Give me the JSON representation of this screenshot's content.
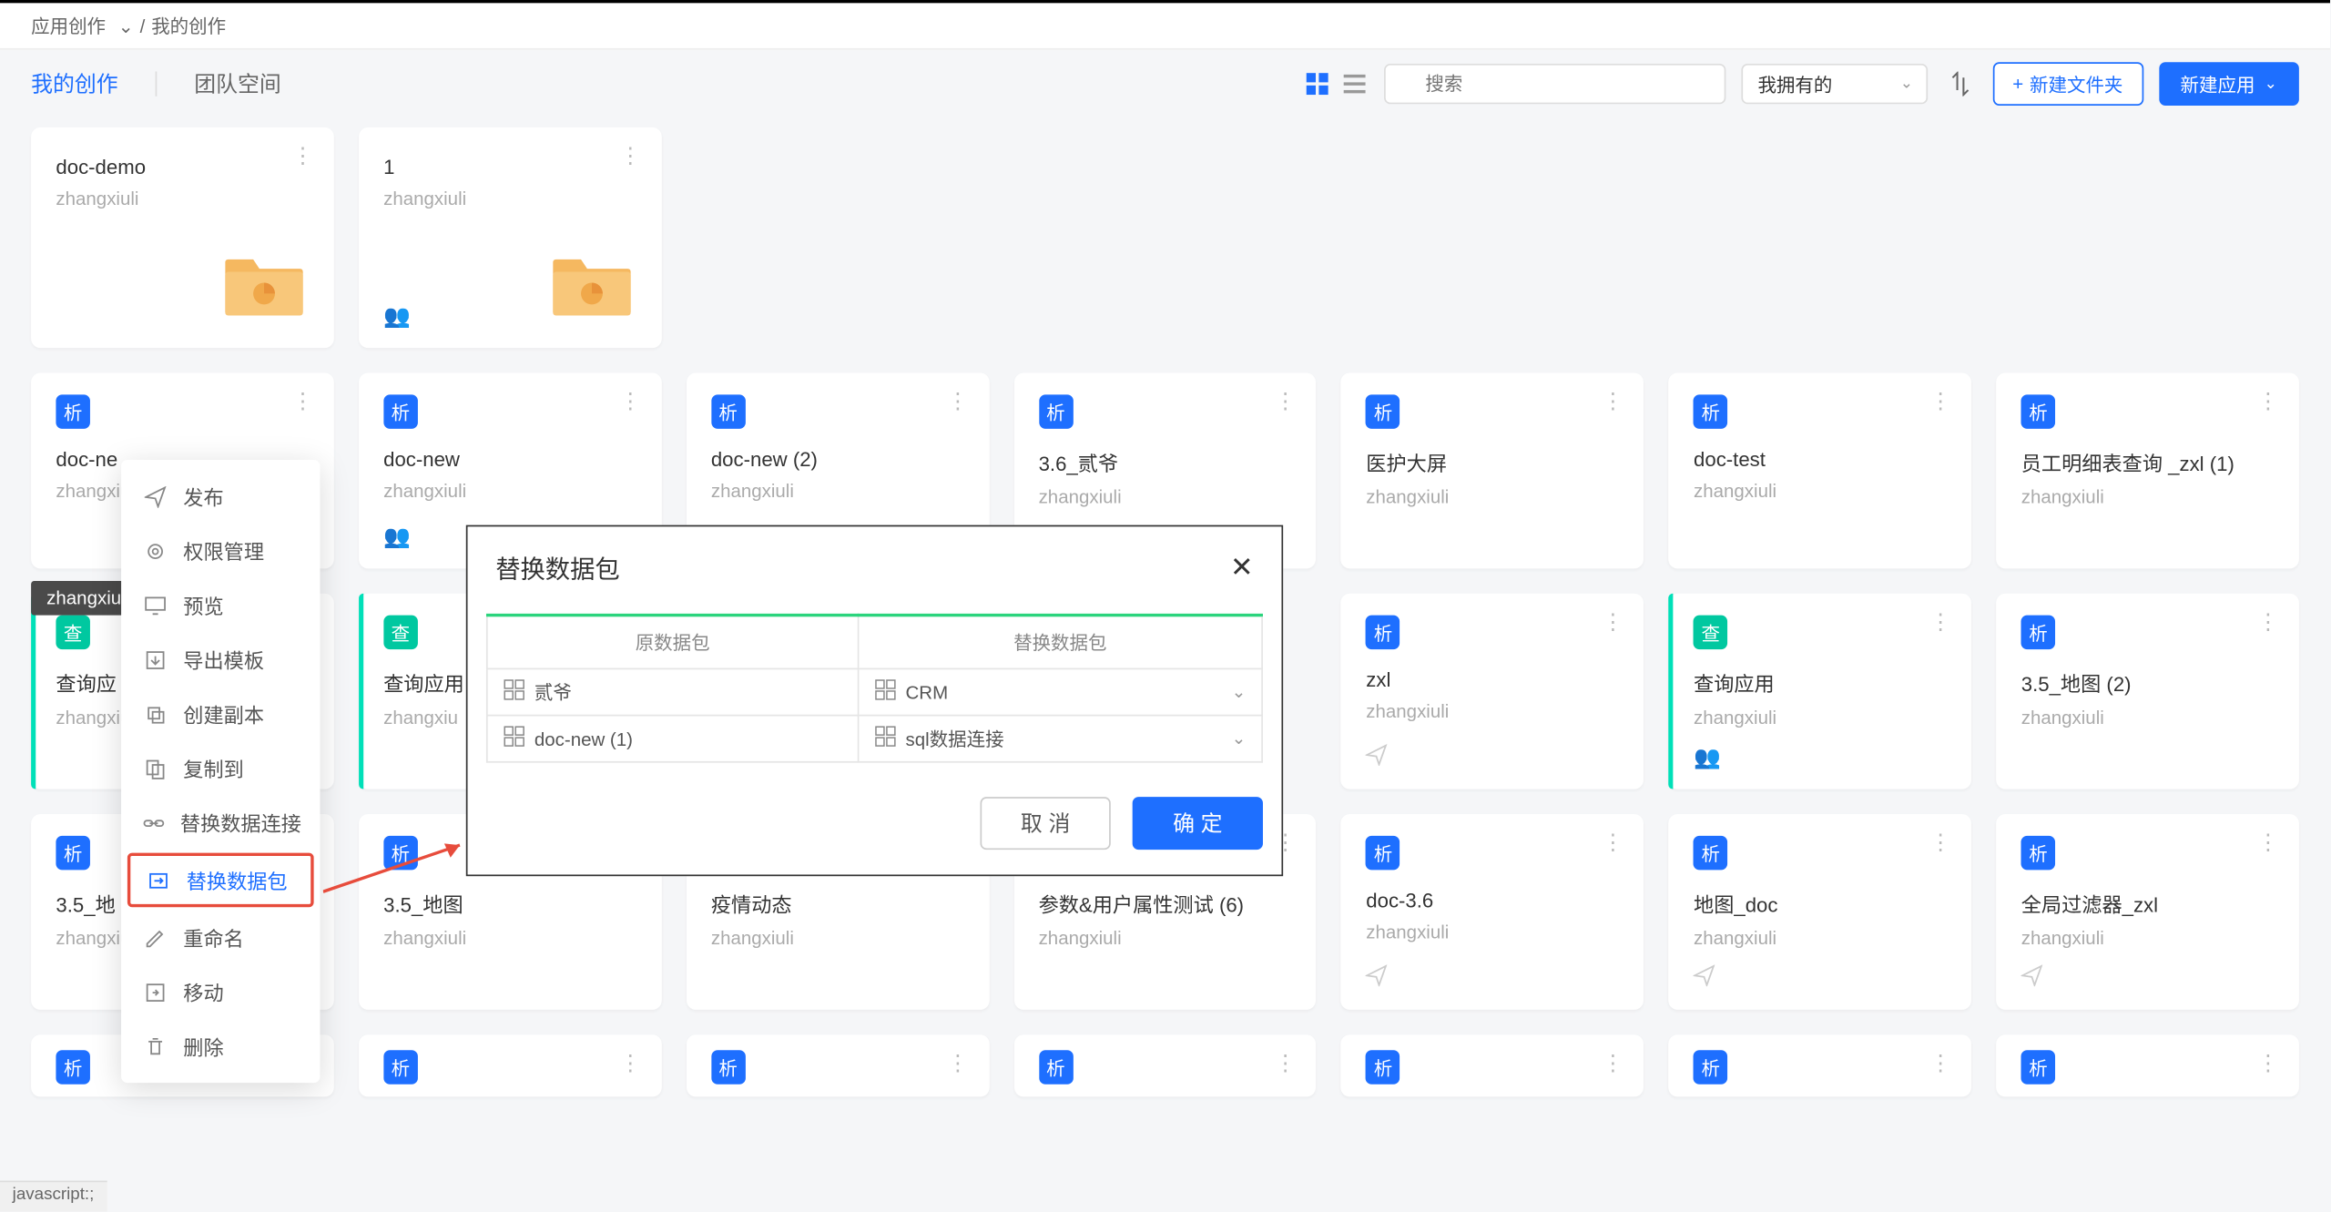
{
  "breadcrumb": {
    "root": "应用创作",
    "sep": "/",
    "current": "我的创作"
  },
  "tabs": {
    "mine": "我的创作",
    "team": "团队空间"
  },
  "search": {
    "placeholder": "搜索"
  },
  "filter": {
    "label": "我拥有的"
  },
  "buttons": {
    "new_folder": "新建文件夹",
    "new_app": "新建应用"
  },
  "tooltip": "zhangxiuli",
  "folders": [
    {
      "title": "doc-demo",
      "sub": "zhangxiuli"
    },
    {
      "title": "1",
      "sub": "zhangxiuli"
    }
  ],
  "cards_row2": [
    {
      "badge": "析",
      "title": "doc-ne",
      "sub": "zhangxiuli",
      "color": "blue"
    },
    {
      "badge": "析",
      "title": "doc-new",
      "sub": "zhangxiuli",
      "color": "blue",
      "shared": true
    },
    {
      "badge": "析",
      "title": "doc-new (2)",
      "sub": "zhangxiuli",
      "color": "blue"
    },
    {
      "badge": "析",
      "title": "3.6_贰爷",
      "sub": "zhangxiuli",
      "color": "blue"
    },
    {
      "badge": "析",
      "title": "医护大屏",
      "sub": "zhangxiuli",
      "color": "blue"
    },
    {
      "badge": "析",
      "title": "doc-test",
      "sub": "zhangxiuli",
      "color": "blue"
    },
    {
      "badge": "析",
      "title": "员工明细表查询 _zxl (1)",
      "sub": "zhangxiuli",
      "color": "blue"
    }
  ],
  "cards_row3": [
    {
      "badge": "查",
      "title": "查询应",
      "sub": "zhangxiu",
      "color": "teal",
      "accent": true
    },
    {
      "badge": "查",
      "title": "查询应用",
      "sub": "zhangxiu",
      "color": "teal",
      "accent": true
    },
    null,
    null,
    {
      "badge": "析",
      "title": "zxl",
      "sub": "zhangxiuli",
      "color": "blue",
      "plane": true
    },
    {
      "badge": "查",
      "title": "查询应用",
      "sub": "zhangxiuli",
      "color": "teal",
      "accent": true,
      "shared": true
    },
    {
      "badge": "析",
      "title": "3.5_地图 (2)",
      "sub": "zhangxiuli",
      "color": "blue"
    }
  ],
  "cards_row4": [
    {
      "badge": "析",
      "title": "3.5_地",
      "sub": "zhangxiu",
      "color": "blue"
    },
    {
      "badge": "析",
      "title": "3.5_地图",
      "sub": "zhangxiuli",
      "color": "blue"
    },
    {
      "badge": "析",
      "title": "疫情动态",
      "sub": "zhangxiuli",
      "color": "blue"
    },
    {
      "badge": "析",
      "title": "参数&用户属性测试 (6)",
      "sub": "zhangxiuli",
      "color": "blue"
    },
    {
      "badge": "析",
      "title": "doc-3.6",
      "sub": "zhangxiuli",
      "color": "blue",
      "plane": true
    },
    {
      "badge": "析",
      "title": "地图_doc",
      "sub": "zhangxiuli",
      "color": "blue",
      "plane": true
    },
    {
      "badge": "析",
      "title": "全局过滤器_zxl",
      "sub": "zhangxiuli",
      "color": "blue",
      "plane": true
    }
  ],
  "cards_row5": [
    {
      "badge": "析",
      "color": "blue"
    },
    {
      "badge": "析",
      "color": "blue"
    },
    {
      "badge": "析",
      "color": "blue"
    },
    {
      "badge": "析",
      "color": "blue"
    },
    {
      "badge": "析",
      "color": "blue"
    },
    {
      "badge": "析",
      "color": "blue"
    },
    {
      "badge": "析",
      "color": "blue"
    }
  ],
  "context_menu": [
    {
      "icon": "plane",
      "label": "发布"
    },
    {
      "icon": "gear",
      "label": "权限管理"
    },
    {
      "icon": "monitor",
      "label": "预览"
    },
    {
      "icon": "export",
      "label": "导出模板"
    },
    {
      "icon": "copy",
      "label": "创建副本"
    },
    {
      "icon": "copyto",
      "label": "复制到"
    },
    {
      "icon": "link",
      "label": "替换数据连接"
    },
    {
      "icon": "replace",
      "label": "替换数据包",
      "highlight": true
    },
    {
      "icon": "rename",
      "label": "重命名"
    },
    {
      "icon": "move",
      "label": "移动"
    },
    {
      "icon": "trash",
      "label": "删除"
    }
  ],
  "modal": {
    "title": "替换数据包",
    "col1": "原数据包",
    "col2": "替换数据包",
    "rows": [
      {
        "orig": "贰爷",
        "repl": "CRM"
      },
      {
        "orig": "doc-new (1)",
        "repl": "sql数据连接"
      }
    ],
    "cancel": "取 消",
    "ok": "确 定"
  },
  "statusbar": "javascript:;"
}
